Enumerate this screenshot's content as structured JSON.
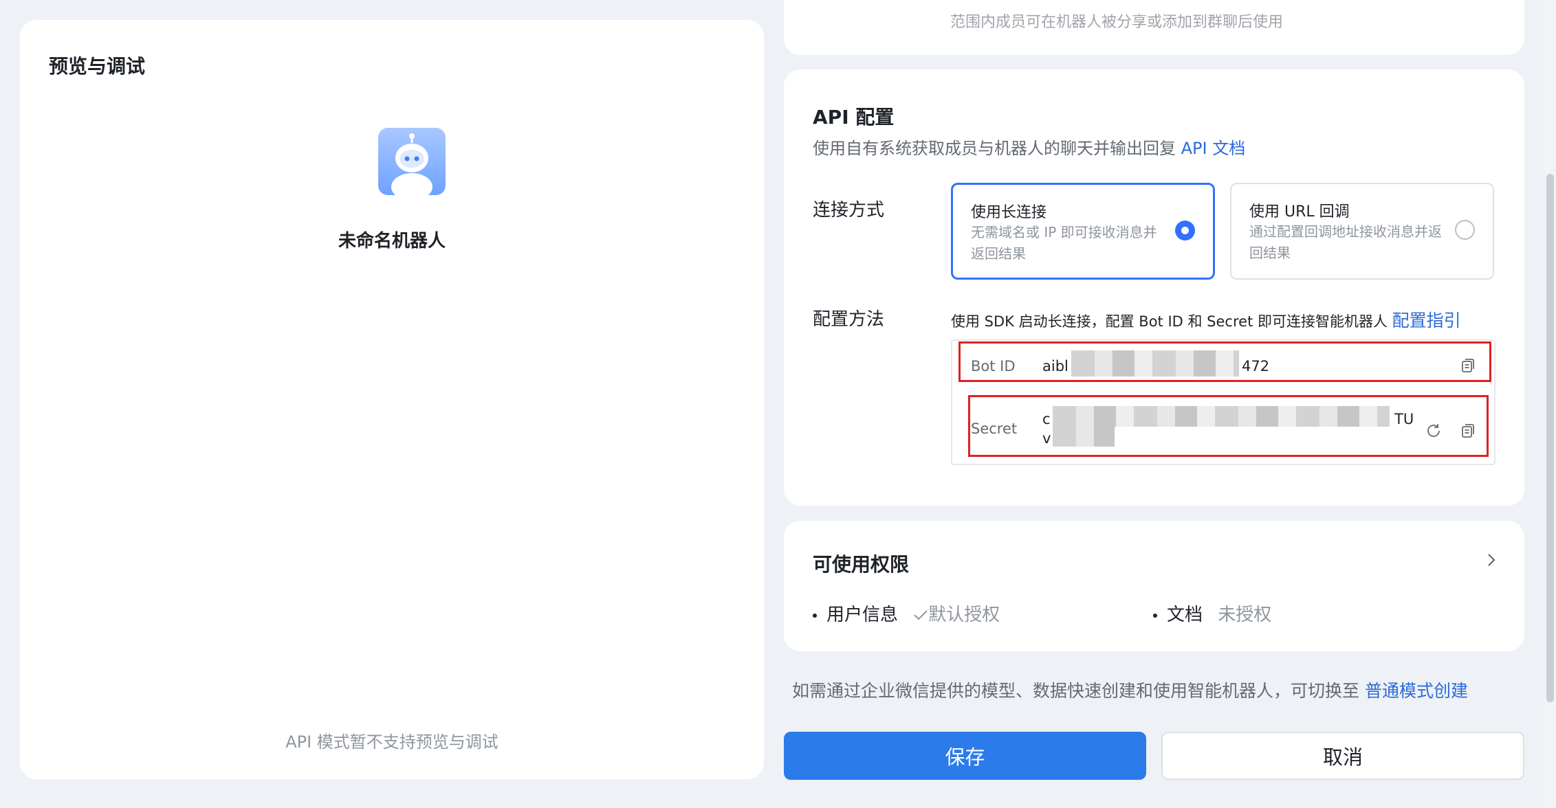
{
  "preview": {
    "title": "预览与调试",
    "bot_name": "未命名机器人",
    "hint": "API 模式暂不支持预览与调试"
  },
  "top_card": {
    "cut_text": "范围内成员可在机器人被分享或添加到群聊后使用"
  },
  "api": {
    "title": "API 配置",
    "desc": "使用自有系统获取成员与机器人的聊天并输出回复",
    "doc_link": "API 文档",
    "conn_label": "连接方式",
    "options": [
      {
        "title": "使用长连接",
        "desc": "无需域名或 IP 即可接收消息并返回结果",
        "selected": true
      },
      {
        "title": "使用 URL 回调",
        "desc": "通过配置回调地址接收消息并返回结果",
        "selected": false
      }
    ],
    "method_label": "配置方法",
    "method_desc": "使用 SDK 启动长连接，配置 Bot ID 和 Secret 即可连接智能机器人",
    "guide_link": "配置指引",
    "bot_id_label": "Bot ID",
    "bot_id_prefix": "aibl",
    "bot_id_suffix": "472",
    "secret_label": "Secret",
    "secret_prefix_1": "c",
    "secret_prefix_2": "v",
    "secret_suffix": "TU"
  },
  "permissions": {
    "title": "可使用权限",
    "items": [
      {
        "name": "用户信息",
        "status": "默认授权"
      },
      {
        "name": "文档",
        "status": "未授权"
      }
    ]
  },
  "switch_hint": {
    "text": "如需通过企业微信提供的模型、数据快速创建和使用智能机器人，可切换至",
    "link": "普通模式创建"
  },
  "buttons": {
    "save": "保存",
    "cancel": "取消"
  },
  "colors": {
    "accent": "#3370ff",
    "link": "#2b6bd8",
    "save_button": "#2b7bea",
    "highlight_box": "#e02020"
  },
  "icons": [
    "robot-avatar-icon",
    "check-icon",
    "copy-icon",
    "refresh-icon",
    "chevron-right-icon"
  ]
}
